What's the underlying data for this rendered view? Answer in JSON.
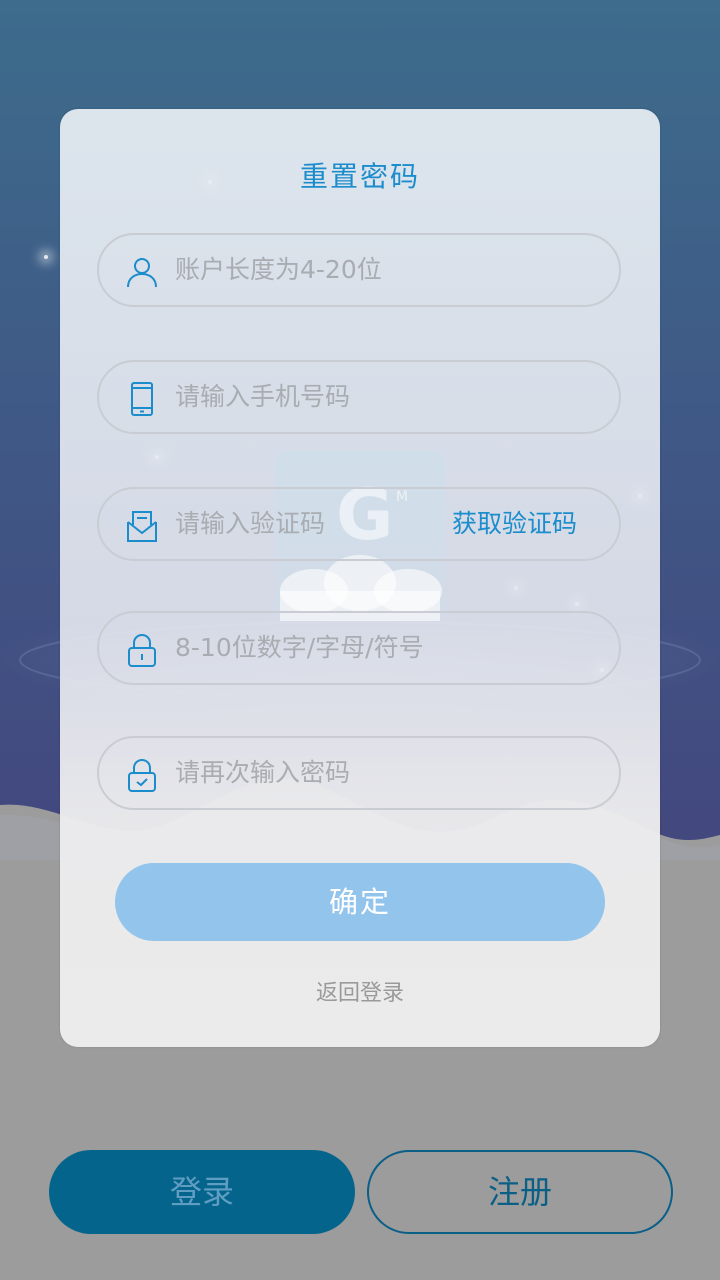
{
  "reset_form": {
    "title": "重置密码",
    "account_placeholder": "账户长度为4-20位",
    "phone_placeholder": "请输入手机号码",
    "code_placeholder": "请输入验证码",
    "get_code_label": "获取验证码",
    "password_placeholder": "8-10位数字/字母/符号",
    "confirm_password_placeholder": "请再次输入密码",
    "confirm_label": "确定",
    "back_to_login_label": "返回登录"
  },
  "bottom_actions": {
    "login_label": "登录",
    "register_label": "注册"
  },
  "icons": {
    "account": "user-icon",
    "phone": "phone-icon",
    "code": "envelope-icon",
    "password": "lock-icon",
    "confirm_password": "lock-check-icon"
  },
  "colors": {
    "accent": "#1b8ccc",
    "confirm_button": "#92c4ec",
    "login_button": "#05648c",
    "sky_top": "#3b6a8c",
    "sky_bottom": "#404c80",
    "ground": "#9c9c9c"
  }
}
